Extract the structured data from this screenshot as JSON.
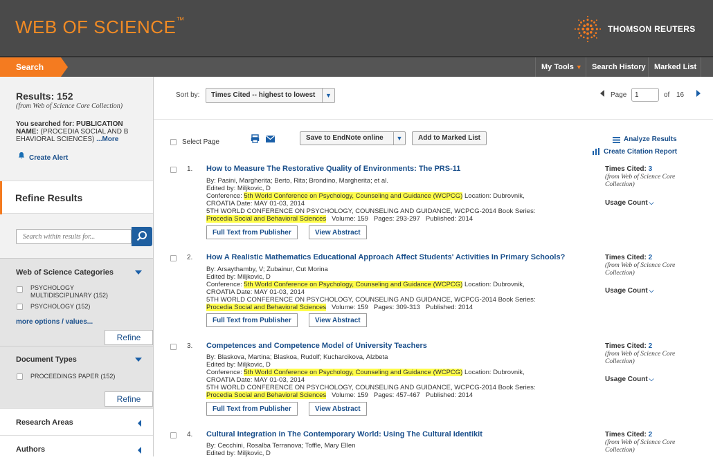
{
  "header": {
    "logo_text": "WEB OF SCIENCE",
    "logo_tm": "™",
    "publisher": "THOMSON REUTERS"
  },
  "nav": {
    "search_tab": "Search",
    "my_tools": "My Tools",
    "search_history": "Search History",
    "marked_list": "Marked List"
  },
  "sidebar": {
    "results_label": "Results: 152",
    "results_source": "(from Web of Science Core Collection)",
    "searched_prefix": "You searched for: PUBLICATION NAME:",
    "searched_query": " (PROCEDIA SOCIAL AND B EHAVIORAL SCIENCES) ",
    "searched_more": "...More",
    "create_alert": "Create Alert",
    "refine_results": "Refine Results",
    "search_within_placeholder": "Search within results for...",
    "panels": {
      "categories": {
        "title": "Web of Science Categories",
        "options": [
          "PSYCHOLOGY MULTIDISCIPLINARY (152)",
          "PSYCHOLOGY (152)"
        ],
        "more": "more options / values...",
        "refine": "Refine"
      },
      "doctypes": {
        "title": "Document Types",
        "options": [
          "PROCEEDINGS PAPER (152)"
        ],
        "refine": "Refine"
      },
      "research_areas": "Research Areas",
      "authors": "Authors"
    }
  },
  "sort": {
    "label": "Sort by:",
    "selected": "Times Cited -- highest to lowest",
    "page_label": "Page",
    "page_value": "1",
    "of_label": "of",
    "total_pages": "16"
  },
  "toolbar": {
    "select_page": "Select Page",
    "save_endnote": "Save to EndNote online",
    "add_marked": "Add to Marked List",
    "analyze": "Analyze Results",
    "citation_report": "Create Citation Report"
  },
  "records": [
    {
      "num": "1.",
      "title": "How to Measure The Restorative Quality of Environments: The PRS-11",
      "by": "By: Pasini, Margherita; Berto, Rita; Brondino, Margherita; et al.",
      "edited": "Edited by: Miljkovic, D",
      "conf_prefix": "Conference: ",
      "conf_name": "5th World Conference on Psychology, Counseling and Guidance (WCPCG)",
      "conf_loc": " Location: Dubrovnik,",
      "date_line": "CROATIA Date: MAY 01-03, 2014",
      "series_prefix": "5TH WORLD CONFERENCE ON PSYCHOLOGY, COUNSELING AND GUIDANCE, WCPCG-2014   Book Series:",
      "series_name": "Procedia Social and Behavioral Sciences",
      "vol_line": "   Volume: 159   Pages: 293-297   Published: 2014",
      "full_text": "Full Text from Publisher",
      "view_abstract": "View Abstract",
      "times_cited_label": "Times Cited: ",
      "times_cited": "3",
      "tc_note": "(from Web of Science Core Collection)",
      "usage": "Usage Count"
    },
    {
      "num": "2.",
      "title": "How A Realistic Mathematics Educational Approach Affect Students' Activities In Primary Schools?",
      "by": "By: Arsaythamby, V; Zubainur, Cut Morina",
      "edited": "Edited by: Miljkovic, D",
      "conf_prefix": "Conference: ",
      "conf_name": "5th World Conference on Psychology, Counseling and Guidance (WCPCG)",
      "conf_loc": " Location: Dubrovnik,",
      "date_line": "CROATIA Date: MAY 01-03, 2014",
      "series_prefix": "5TH WORLD CONFERENCE ON PSYCHOLOGY, COUNSELING AND GUIDANCE, WCPCG-2014   Book Series:",
      "series_name": "Procedia Social and Behavioral Sciences",
      "vol_line": "   Volume: 159   Pages: 309-313   Published: 2014",
      "full_text": "Full Text from Publisher",
      "view_abstract": "View Abstract",
      "times_cited_label": "Times Cited: ",
      "times_cited": "2",
      "tc_note": "(from Web of Science Core Collection)",
      "usage": "Usage Count"
    },
    {
      "num": "3.",
      "title": "Competences and Competence Model of University Teachers",
      "by": "By: Blaskova, Martina; Blaskoa, Rudolf; Kucharcikova, Alzbeta",
      "edited": "Edited by: Miljkovic, D",
      "conf_prefix": "Conference: ",
      "conf_name": "5th World Conference on Psychology, Counseling and Guidance (WCPCG)",
      "conf_loc": " Location: Dubrovnik,",
      "date_line": "CROATIA Date: MAY 01-03, 2014",
      "series_prefix": "5TH WORLD CONFERENCE ON PSYCHOLOGY, COUNSELING AND GUIDANCE, WCPCG-2014   Book Series:",
      "series_name": "Procedia Social and Behavioral Sciences",
      "vol_line": "   Volume: 159   Pages: 457-467   Published: 2014",
      "full_text": "Full Text from Publisher",
      "view_abstract": "View Abstract",
      "times_cited_label": "Times Cited: ",
      "times_cited": "2",
      "tc_note": "(from Web of Science Core Collection)",
      "usage": "Usage Count"
    },
    {
      "num": "4.",
      "title": "Cultural Integration in The Contemporary World: Using The Cultural Identikit",
      "by": "By: Cecchini, Rosalba Terranova; Toffle, Mary Ellen",
      "edited": "Edited by: Miljkovic, D",
      "times_cited_label": "Times Cited: ",
      "times_cited": "2",
      "tc_note": "(from Web of Science Core Collection)"
    }
  ],
  "colors": {
    "accent": "#f47b20",
    "link": "#1a4f8b",
    "highlight": "#fffd4a",
    "header_bg": "#4a4a4a"
  }
}
